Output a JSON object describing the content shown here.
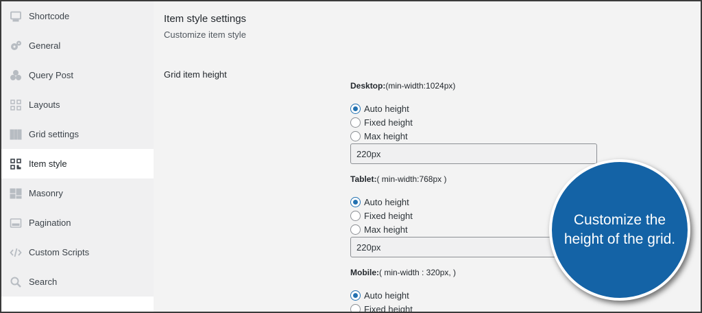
{
  "sidebar": {
    "items": [
      {
        "label": "Shortcode",
        "icon": "monitor-icon"
      },
      {
        "label": "General",
        "icon": "gears-icon"
      },
      {
        "label": "Query Post",
        "icon": "database-icon"
      },
      {
        "label": "Layouts",
        "icon": "grid-small-icon"
      },
      {
        "label": "Grid settings",
        "icon": "grid-icon"
      },
      {
        "label": "Item style",
        "icon": "qrcode-icon",
        "active": true
      },
      {
        "label": "Masonry",
        "icon": "masonry-icon"
      },
      {
        "label": "Pagination",
        "icon": "pagination-icon"
      },
      {
        "label": "Custom Scripts",
        "icon": "code-icon"
      },
      {
        "label": "Search",
        "icon": "search-icon"
      }
    ]
  },
  "main": {
    "title": "Item style settings",
    "subtitle": "Customize item style",
    "field_label": "Grid item height",
    "groups": [
      {
        "device": "Desktop:",
        "spec": "(min-width:1024px)",
        "options": [
          "Auto height",
          "Fixed height",
          "Max height"
        ],
        "selected": "Auto height",
        "value": "220px"
      },
      {
        "device": "Tablet:",
        "spec": "( min-width:768px )",
        "options": [
          "Auto height",
          "Fixed height",
          "Max height"
        ],
        "selected": "Auto height",
        "value": "220px"
      },
      {
        "device": "Mobile:",
        "spec": "( min-width : 320px, )",
        "options": [
          "Auto height",
          "Fixed height"
        ],
        "selected": "Auto height"
      }
    ]
  },
  "callout": {
    "text": "Customize the height of the grid.",
    "color": "#1463a6"
  },
  "colors": {
    "accent": "#2271b1",
    "sidebar_bg": "#f0f0f1",
    "content_bg": "#f3f3f3"
  }
}
